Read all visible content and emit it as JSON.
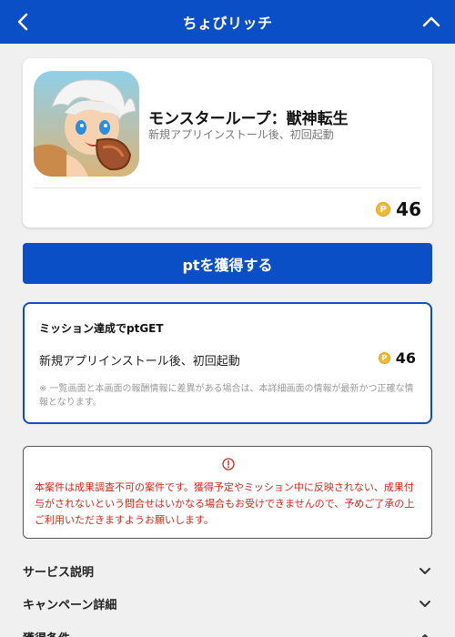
{
  "header": {
    "title": "ちょびリッチ",
    "back_icon": "chevron-left-icon",
    "collapse_icon": "chevron-up-icon",
    "bg_color": "#0b4fc6"
  },
  "app_card": {
    "app_name": "モンスターループ：獣神転生",
    "condition": "新規アプリインストール後、初回起動",
    "points": "46",
    "coin_symbol": "P"
  },
  "cta": {
    "label": "ptを獲得する"
  },
  "mission": {
    "title": "ミッション達成でptGET",
    "item_label": "新規アプリインストール後、初回起動",
    "points": "46",
    "coin_symbol": "P",
    "note": "※ 一覧画面と本画面の報酬情報に差異がある場合は、本詳細画面の情報が最新かつ正確な情報となります。"
  },
  "warning": {
    "icon": "info-circle-icon",
    "text": "本案件は成果調査不可の案件です。獲得予定やミッション中に反映されない、成果付与がされないという問合せはいかなる場合もお受けできませんので、予めご了承の上ご利用いただきますようお願いします。",
    "color": "#d3261a"
  },
  "sections": [
    {
      "label": "サービス説明",
      "state": "collapsed"
    },
    {
      "label": "キャンペーン詳細",
      "state": "collapsed"
    },
    {
      "label": "獲得条件",
      "state": "expanded"
    }
  ]
}
